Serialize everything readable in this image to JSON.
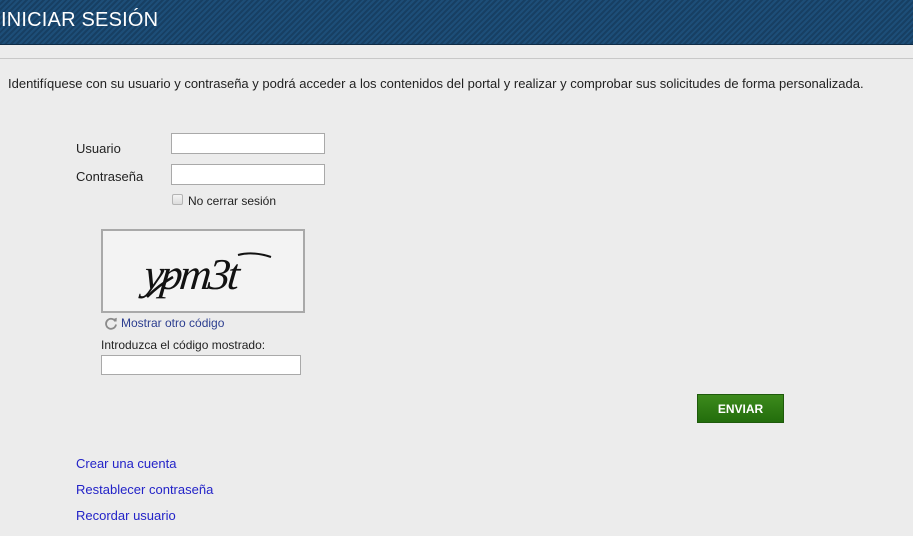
{
  "header": {
    "title": "INICIAR SESIÓN"
  },
  "intro_text": "Identifíquese con su usuario y contraseña y podrá acceder a los contenidos del portal y realizar y comprobar sus solicitudes de forma personalizada.",
  "form": {
    "username_label": "Usuario",
    "username_value": "",
    "password_label": "Contraseña",
    "password_value": "",
    "remember_label": "No cerrar sesión",
    "remember_checked": false
  },
  "captcha": {
    "image_text": "ypm3t",
    "refresh_label": "Mostrar otro código",
    "refresh_icon": "refresh-icon",
    "prompt_label": "Introduzca el código mostrado:",
    "input_value": ""
  },
  "submit_label": "ENVIAR",
  "links": [
    {
      "label": "Crear una cuenta"
    },
    {
      "label": "Restablecer contraseña"
    },
    {
      "label": "Recordar usuario"
    }
  ],
  "colors": {
    "header_bg": "#1d4e78",
    "submit_bg": "#2e7d14",
    "link": "#2323c8",
    "refresh_link": "#2b3d8f"
  }
}
